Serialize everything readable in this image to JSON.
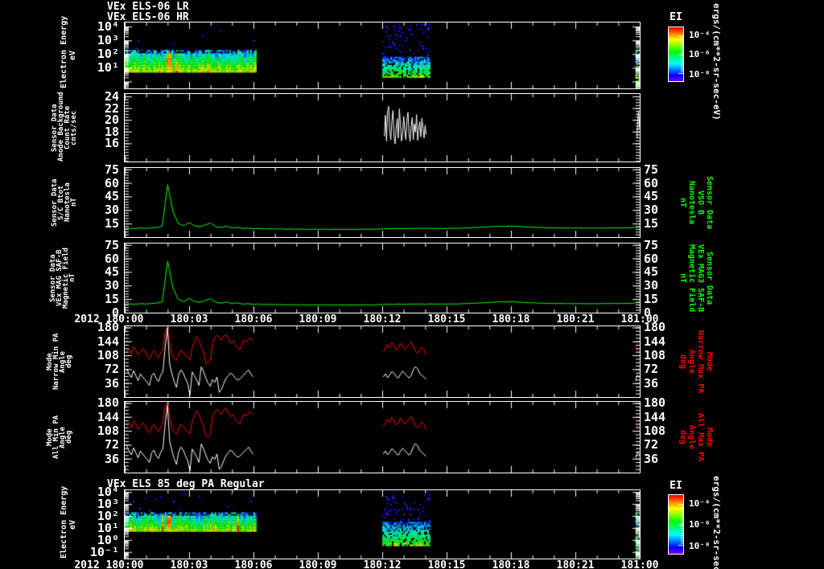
{
  "colors": {
    "background": "#000000",
    "foreground": "#ffffff",
    "line_green": "#00ff00",
    "line_red": "#ff0000",
    "line_white": "#ffffff"
  },
  "time_axis": {
    "year": "2012",
    "tick_hours": [
      0,
      3,
      6,
      9,
      12,
      15,
      18,
      21,
      24
    ],
    "minor_hour_step": 1,
    "tick_labels": [
      "180:00",
      "180:03",
      "180:06",
      "180:09",
      "180:12",
      "180:15",
      "180:18",
      "180:21",
      "181:00"
    ]
  },
  "colorbar": {
    "title": "EI",
    "tick_labels": [
      "10⁻⁴",
      "10⁻⁶",
      "10⁻⁸"
    ],
    "unit": "ergs/(cm**2-sr-sec-eV)"
  },
  "chart_data": [
    {
      "id": "els06_spectrogram",
      "type": "heatmap",
      "title_lines": [
        "VEx ELS-06 LR",
        "VEx ELS-06 HR"
      ],
      "ylabel_left": "Electron Energy\neV",
      "yscale": "log",
      "ylog_range": [
        -0.5,
        4.3
      ],
      "ytick_decades": [
        4,
        3,
        2,
        1
      ],
      "ytick_labels": [
        "10⁴",
        "10³",
        "10²",
        "10¹"
      ],
      "colorbar_label": "EI",
      "segments": [
        {
          "kind": "band",
          "t": [
            0.0,
            6.1
          ],
          "log_e": [
            0.76,
            2.29
          ],
          "streak_t": [
            1.88,
            2.1
          ]
        },
        {
          "kind": "sparse",
          "t": [
            12.0,
            14.2
          ],
          "dense_log_e": [
            0.3,
            1.8
          ],
          "sparse_log_e_max": 4.2
        },
        {
          "kind": "edge",
          "t": [
            23.8,
            24.0
          ],
          "log_e": [
            -0.4,
            2.3
          ]
        }
      ]
    },
    {
      "id": "anode_background",
      "type": "line",
      "ylabel_left": "Sensor Data\nAnode Background\nCount Rate\ncnts/sec",
      "yrange": [
        12.9,
        24.4
      ],
      "yticks": [
        16,
        18,
        20,
        22,
        24
      ],
      "yminor": 0.5,
      "series": [
        {
          "name": "count_rate",
          "color": "#ffffff",
          "segments": [
            {
              "t0": 12.1,
              "dt": 0.05,
              "values": [
                17.2,
                20.8,
                16.4,
                21.4,
                22.3,
                18.2,
                16.6,
                19.8,
                21.6,
                17.2,
                15.9,
                18.6,
                20.2,
                16.9,
                21.9,
                19.2,
                16.4,
                17.6,
                20.6,
                18.3,
                16.6,
                19.9,
                21.3,
                17.6,
                16.3,
                18.9,
                20.4,
                16.6,
                19.3,
                17.9,
                20.9,
                16.5,
                18.3,
                19.7,
                17.1,
                20.3,
                18.6,
                16.9,
                19.1,
                17.5
              ]
            },
            {
              "t0": 23.88,
              "dt": 0.06,
              "values": [
                17.0,
                21.5,
                18.5
              ]
            }
          ]
        }
      ]
    },
    {
      "id": "sc_btot",
      "type": "line",
      "ylabel_left": "Sensor Data\nS/C Btot\nNanotesla\nnT",
      "ylabel_right": "Sensor Data\nVSO B\nNanotesla\nnT",
      "ylabel_right_color": "#00ff00",
      "yrange": [
        0,
        76.5
      ],
      "yticks": [
        15,
        30,
        45,
        60,
        75
      ],
      "yticks_right": [
        15,
        30,
        45,
        60,
        75
      ],
      "yminor": 3,
      "series": [
        {
          "name": "sc_btot_nT",
          "color": "#00ff00",
          "segments": [
            {
              "t0": 0,
              "dt": 0.25,
              "values": [
                9.5,
                9.8,
                9.4,
                10.1,
                9.6,
                10.2,
                10.6,
                12,
                58,
                28,
                15,
                12.5,
                16,
                12.5,
                11.5,
                13.5,
                15.5,
                11.5,
                10.5,
                12,
                10,
                11,
                9.5,
                10,
                9.2,
                9.6,
                9.0,
                9.3,
                8.9,
                9.2,
                8.7,
                9.0,
                8.6,
                8.9,
                8.5,
                8.8,
                8.5,
                8.8,
                8.4,
                8.7,
                8.5,
                8.8,
                8.4,
                8.7,
                8.5,
                8.8,
                8.5,
                8.9,
                9.1,
                9.4,
                9.2,
                9.6,
                9.3,
                9.7,
                9.4,
                9.8,
                9.5,
                9.8,
                9.4,
                9.7,
                9.5,
                9.8,
                9.6,
                10.0,
                10.2,
                10.5,
                10.7,
                11.0,
                11.3,
                11.8,
                12.1,
                11.8,
                12.2,
                11.9,
                11.5,
                11.2,
                11.0,
                10.7,
                10.5,
                10.3,
                10.1,
                10.3,
                10.0,
                10.2,
                9.9,
                10.2,
                9.9,
                10.1,
                9.9,
                10.2,
                10.0,
                10.3,
                10.1,
                10.4,
                10.2,
                10.7,
                11.1
              ]
            }
          ]
        }
      ]
    },
    {
      "id": "vex_mag_saf_b",
      "type": "line",
      "ylabel_left": "Sensor Data\nVEx MAG SAF-B\nMagnetic Field\nnT",
      "ylabel_right": "Sensor Data\nVEx MAG3 SAF-B\nMagnetic Field\nnT",
      "ylabel_right_color": "#00ff00",
      "yrange": [
        0,
        76.5
      ],
      "yticks": [
        0,
        15,
        30,
        45,
        60,
        75
      ],
      "yticks_right": [
        0,
        15,
        30,
        45,
        60,
        75
      ],
      "yminor": 3,
      "series": [
        {
          "name": "vex_mag_nT",
          "color": "#00ff00",
          "segments": [
            {
              "t0": 0,
              "dt": 0.25,
              "values": [
                9.4,
                9.7,
                9.3,
                10.0,
                9.5,
                10.1,
                10.5,
                12,
                57,
                27,
                14.5,
                12.3,
                15.8,
                12.4,
                11.4,
                13.4,
                15.4,
                11.4,
                10.4,
                11.9,
                9.9,
                10.9,
                9.4,
                9.9,
                9.1,
                9.5,
                8.9,
                9.2,
                8.8,
                9.1,
                8.6,
                8.9,
                8.5,
                8.8,
                8.4,
                8.7,
                8.4,
                8.7,
                8.3,
                8.6,
                8.4,
                8.7,
                8.3,
                8.6,
                8.4,
                8.7,
                8.4,
                8.8,
                9.0,
                9.3,
                9.1,
                9.5,
                9.2,
                9.6,
                9.3,
                9.7,
                9.4,
                9.7,
                9.3,
                9.6,
                9.4,
                9.7,
                9.5,
                9.9,
                10.1,
                10.4,
                10.6,
                10.9,
                11.2,
                11.7,
                12.0,
                11.7,
                12.1,
                11.8,
                11.4,
                11.1,
                10.9,
                10.6,
                10.4,
                10.2,
                10.0,
                10.2,
                9.9,
                10.1,
                9.8,
                10.1,
                9.8,
                10.0,
                9.8,
                10.1,
                9.9,
                10.2,
                10.0,
                10.3,
                10.1,
                10.6,
                11.0
              ]
            }
          ]
        }
      ]
    },
    {
      "id": "narrow_pa",
      "type": "line",
      "ylabel_left": "Mode\nNarrow Min PA\nAngle\ndeg",
      "ylabel_right": "Mode\nNarrow Max PA\nAngle\ndeg",
      "ylabel_right_color": "#ff0000",
      "yrange": [
        0,
        183
      ],
      "yticks": [
        36,
        72,
        108,
        144,
        180
      ],
      "yticks_right": [
        36,
        72,
        108,
        144,
        180
      ],
      "yminor": 9,
      "series": [
        {
          "name": "narrow_max_pa",
          "color": "#ff0000",
          "segments": [
            {
              "t0": 0.1,
              "dt": 0.105,
              "values": [
                118,
                125,
                112,
                130,
                122,
                108,
                115,
                126,
                119,
                105,
                98,
                112,
                120,
                109,
                102,
                114,
                125,
                172,
                181,
                138,
                112,
                100,
                95,
                110,
                121,
                115,
                108,
                102,
                96,
                128,
                142,
                156,
                148,
                130,
                118,
                90,
                86,
                94,
                140,
                152,
                160,
                154,
                146,
                158,
                162,
                150,
                140,
                146,
                136,
                128,
                122,
                135,
                148,
                142,
                150,
                154,
                146
              ]
            },
            {
              "t0": 12.05,
              "dt": 0.1,
              "values": [
                116,
                126,
                136,
                128,
                141,
                133,
                121,
                127,
                139,
                131,
                123,
                129,
                136,
                143,
                131,
                119,
                113,
                121,
                129,
                123,
                109
              ]
            },
            {
              "t0": 23.8,
              "dt": 0.1,
              "values": [
                132,
                121,
                114
              ]
            }
          ]
        },
        {
          "name": "narrow_min_pa",
          "color": "#ffffff",
          "segments": [
            {
              "t0": 0.1,
              "dt": 0.105,
              "values": [
                72,
                60,
                50,
                68,
                55,
                42,
                60,
                52,
                45,
                38,
                30,
                55,
                62,
                48,
                40,
                56,
                66,
                130,
                178,
                85,
                60,
                40,
                25,
                58,
                70,
                62,
                48,
                35,
                5,
                65,
                55,
                44,
                30,
                78,
                66,
                50,
                36,
                28,
                45,
                38,
                52,
                12,
                20,
                35,
                48,
                55,
                62,
                58,
                50,
                44,
                46,
                52,
                58,
                64,
                70,
                60,
                52
              ]
            },
            {
              "t0": 12.05,
              "dt": 0.1,
              "values": [
                52,
                60,
                50,
                57,
                66,
                61,
                53,
                49,
                59,
                67,
                61,
                55,
                49,
                56,
                71,
                79,
                73,
                61,
                56,
                51,
                46
              ]
            },
            {
              "t0": 23.8,
              "dt": 0.1,
              "values": [
                42,
                57,
                50
              ]
            }
          ]
        }
      ]
    },
    {
      "id": "all_pa",
      "type": "line",
      "ylabel_left": "Mode\nAll Min PA\nAngle\ndeg",
      "ylabel_right": "Mode\nAll Max PA\nAngle\ndeg",
      "ylabel_right_color": "#ff0000",
      "yrange": [
        0,
        183
      ],
      "yticks": [
        36,
        72,
        108,
        144,
        180
      ],
      "yticks_right": [
        36,
        72,
        108,
        144,
        180
      ],
      "yminor": 9,
      "series": [
        {
          "name": "all_max_pa",
          "color": "#ff0000",
          "segments": [
            {
              "t0": 0.1,
              "dt": 0.105,
              "values": [
                122,
                129,
                116,
                134,
                126,
                112,
                119,
                130,
                123,
                109,
                102,
                116,
                124,
                113,
                106,
                118,
                129,
                175,
                181,
                142,
                116,
                104,
                99,
                114,
                125,
                119,
                112,
                106,
                100,
                132,
                146,
                160,
                152,
                134,
                122,
                94,
                90,
                98,
                144,
                156,
                164,
                158,
                150,
                162,
                166,
                154,
                144,
                150,
                140,
                132,
                126,
                139,
                152,
                146,
                154,
                158,
                150
              ]
            },
            {
              "t0": 12.05,
              "dt": 0.1,
              "values": [
                118,
                128,
                138,
                130,
                143,
                135,
                123,
                129,
                141,
                133,
                125,
                131,
                138,
                145,
                133,
                121,
                115,
                123,
                131,
                125,
                111
              ]
            },
            {
              "t0": 23.8,
              "dt": 0.1,
              "values": [
                128,
                118,
                124
              ]
            }
          ]
        },
        {
          "name": "all_min_pa",
          "color": "#ffffff",
          "segments": [
            {
              "t0": 0.1,
              "dt": 0.105,
              "values": [
                68,
                56,
                46,
                64,
                51,
                38,
                56,
                48,
                41,
                34,
                26,
                51,
                58,
                44,
                36,
                52,
                62,
                126,
                174,
                81,
                56,
                36,
                21,
                54,
                66,
                58,
                44,
                31,
                4,
                61,
                51,
                40,
                26,
                74,
                62,
                46,
                32,
                24,
                41,
                34,
                48,
                8,
                16,
                31,
                44,
                51,
                58,
                54,
                46,
                40,
                42,
                48,
                54,
                60,
                66,
                56,
                48
              ]
            },
            {
              "t0": 12.05,
              "dt": 0.1,
              "values": [
                48,
                56,
                46,
                53,
                62,
                57,
                49,
                45,
                55,
                63,
                57,
                51,
                45,
                52,
                67,
                75,
                69,
                57,
                52,
                47,
                42
              ]
            },
            {
              "t0": 23.8,
              "dt": 0.1,
              "values": [
                38,
                52,
                46
              ]
            }
          ]
        }
      ]
    },
    {
      "id": "els85_spectrogram",
      "type": "heatmap",
      "title_lines": [
        "VEx ELS 85 deg PA Regular"
      ],
      "ylabel_left": "Electron Energy\neV",
      "yscale": "log",
      "ylog_range": [
        -1.55,
        4.15
      ],
      "ytick_decades": [
        4,
        3,
        2,
        1,
        0,
        -1
      ],
      "ytick_labels": [
        "10⁴",
        "10³",
        "10²",
        "10¹",
        "10⁰",
        "10⁻¹"
      ],
      "colorbar_label": "EI",
      "segments": [
        {
          "kind": "band",
          "t": [
            0.0,
            6.1
          ],
          "log_e": [
            0.7,
            2.3
          ],
          "streak_t": [
            1.88,
            2.1
          ]
        },
        {
          "kind": "sparse",
          "t": [
            12.0,
            14.2
          ],
          "dense_log_e": [
            -0.5,
            1.5
          ],
          "sparse_log_e_max": 3.8
        },
        {
          "kind": "edge",
          "t": [
            23.8,
            24.0
          ],
          "log_e": [
            -1.4,
            2.3
          ]
        }
      ]
    }
  ]
}
